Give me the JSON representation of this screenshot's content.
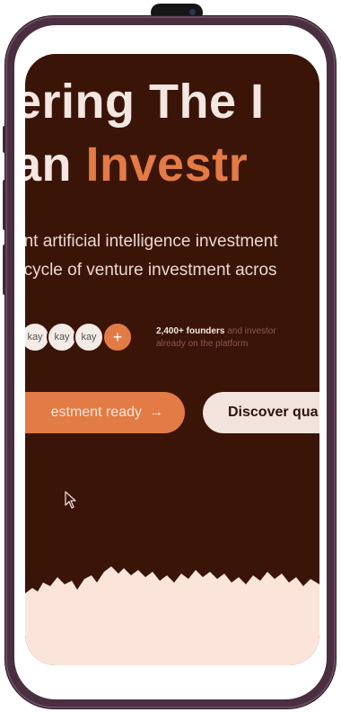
{
  "hero": {
    "headline_line1": "ering The I",
    "headline_line2_prefix": "an ",
    "headline_line2_accent": "Investr"
  },
  "subtitle": {
    "line1": "ent artificial intelligence investment",
    "line2": "ecycle of venture investment acros"
  },
  "social_proof": {
    "avatars": [
      {
        "label": "kay"
      },
      {
        "label": "kay"
      },
      {
        "label": "kay"
      }
    ],
    "plus_symbol": "+",
    "founders_strong": "2,400+ founders",
    "founders_rest": " and investor",
    "founders_line2": "already on the platform"
  },
  "buttons": {
    "primary_label": "estment ready",
    "primary_arrow": "→",
    "secondary_label": "Discover qua"
  },
  "colors": {
    "background": "#3b1408",
    "accent": "#e27b45",
    "light": "#f4e7e2",
    "frame": "#4a2f40"
  },
  "icons": {
    "cursor": "mouse-pointer-icon",
    "plus": "plus-icon",
    "arrow": "arrow-right-icon",
    "camera": "front-camera-icon"
  }
}
